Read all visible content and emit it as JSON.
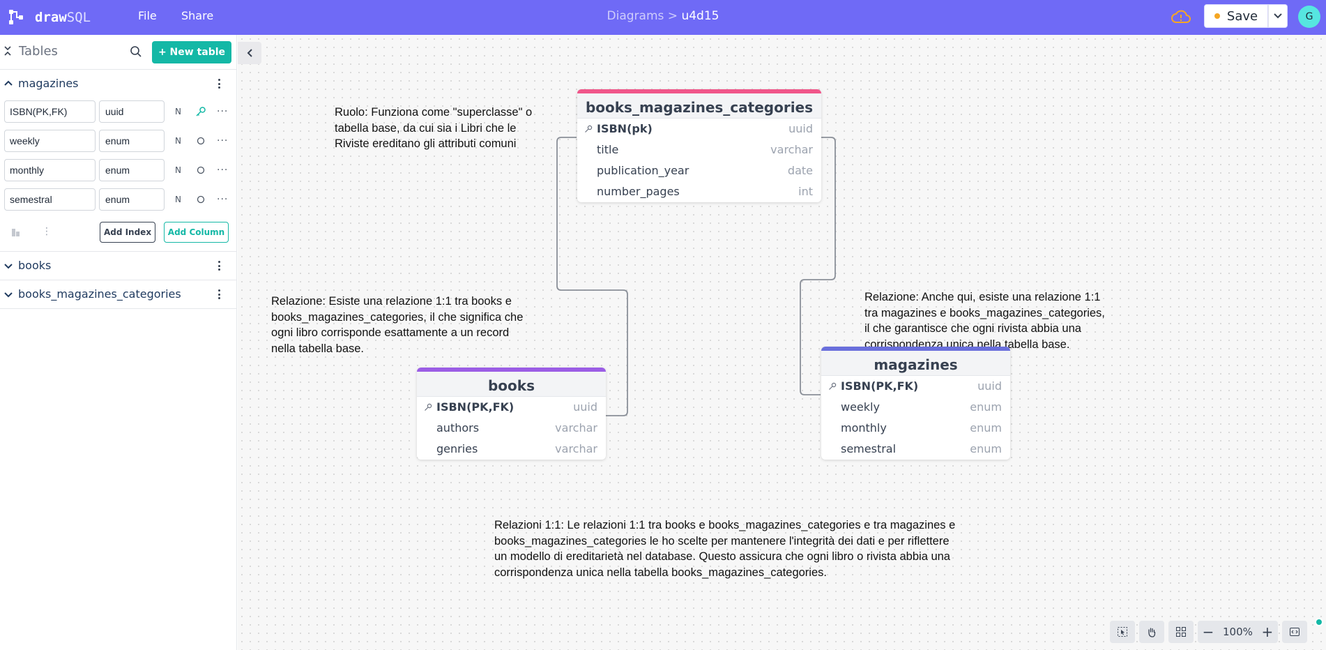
{
  "app": {
    "logo_bold": "draw",
    "logo_light": "SQL",
    "menu": [
      "File",
      "Share"
    ],
    "breadcrumb_parent": "Diagrams >",
    "breadcrumb_current": "u4d15",
    "save_label": "Save",
    "avatar_initial": "G",
    "accent_color": "#6f6af6"
  },
  "sidebar": {
    "title": "Tables",
    "new_table_label": "+ New table",
    "expanded_table": {
      "name": "magazines",
      "columns": [
        {
          "name": "ISBN(PK,FK)",
          "type": "uuid",
          "nullable": "N",
          "key_icon": "key-icon"
        },
        {
          "name": "weekly",
          "type": "enum",
          "nullable": "N",
          "key_icon": "circle-icon"
        },
        {
          "name": "monthly",
          "type": "enum",
          "nullable": "N",
          "key_icon": "circle-icon"
        },
        {
          "name": "semestral",
          "type": "enum",
          "nullable": "N",
          "key_icon": "circle-icon"
        }
      ],
      "add_index_label": "Add Index",
      "add_column_label": "Add Column"
    },
    "collapsed_tables": [
      "books",
      "books_magazines_categories"
    ]
  },
  "canvas": {
    "notes": {
      "superclass": "Ruolo: Funziona come \"superclasse\" o\ntabella base, da cui sia i Libri che le\nRiviste ereditano gli attributi comuni",
      "books_relation": "Relazione: Esiste una relazione 1:1 tra books e\nbooks_magazines_categories, il che significa che\nogni libro corrisponde esattamente a un record\nnella tabella base.",
      "magazines_relation": "Relazione: Anche qui, esiste una relazione 1:1\ntra magazines e books_magazines_categories,\nil che garantisce che ogni rivista abbia una\ncorrispondenza unica nella tabella base.",
      "summary": "Relazioni 1:1: Le relazioni 1:1 tra books e books_magazines_categories e tra magazines e\nbooks_magazines_categories le ho scelte per mantenere l'integrità dei dati e per riflettere\nun modello di ereditarietà nel database. Questo assicura che ogni libro o rivista abbia una\ncorrispondenza unica nella tabella books_magazines_categories."
    },
    "tables": {
      "categories": {
        "name": "books_magazines_categories",
        "color": "#f0568a",
        "fields": [
          {
            "name": "ISBN(pk)",
            "type": "uuid"
          },
          {
            "name": "title",
            "type": "varchar"
          },
          {
            "name": "publication_year",
            "type": "date"
          },
          {
            "name": "number_pages",
            "type": "int"
          }
        ]
      },
      "books": {
        "name": "books",
        "color": "#9b5de5",
        "fields": [
          {
            "name": "ISBN(PK,FK)",
            "type": "uuid"
          },
          {
            "name": "authors",
            "type": "varchar"
          },
          {
            "name": "genries",
            "type": "varchar"
          }
        ]
      },
      "magazines": {
        "name": "magazines",
        "color": "#6a6fdc",
        "fields": [
          {
            "name": "ISBN(PK,FK)",
            "type": "uuid"
          },
          {
            "name": "weekly",
            "type": "enum"
          },
          {
            "name": "monthly",
            "type": "enum"
          },
          {
            "name": "semestral",
            "type": "enum"
          }
        ]
      }
    },
    "zoom_level": "100%"
  }
}
